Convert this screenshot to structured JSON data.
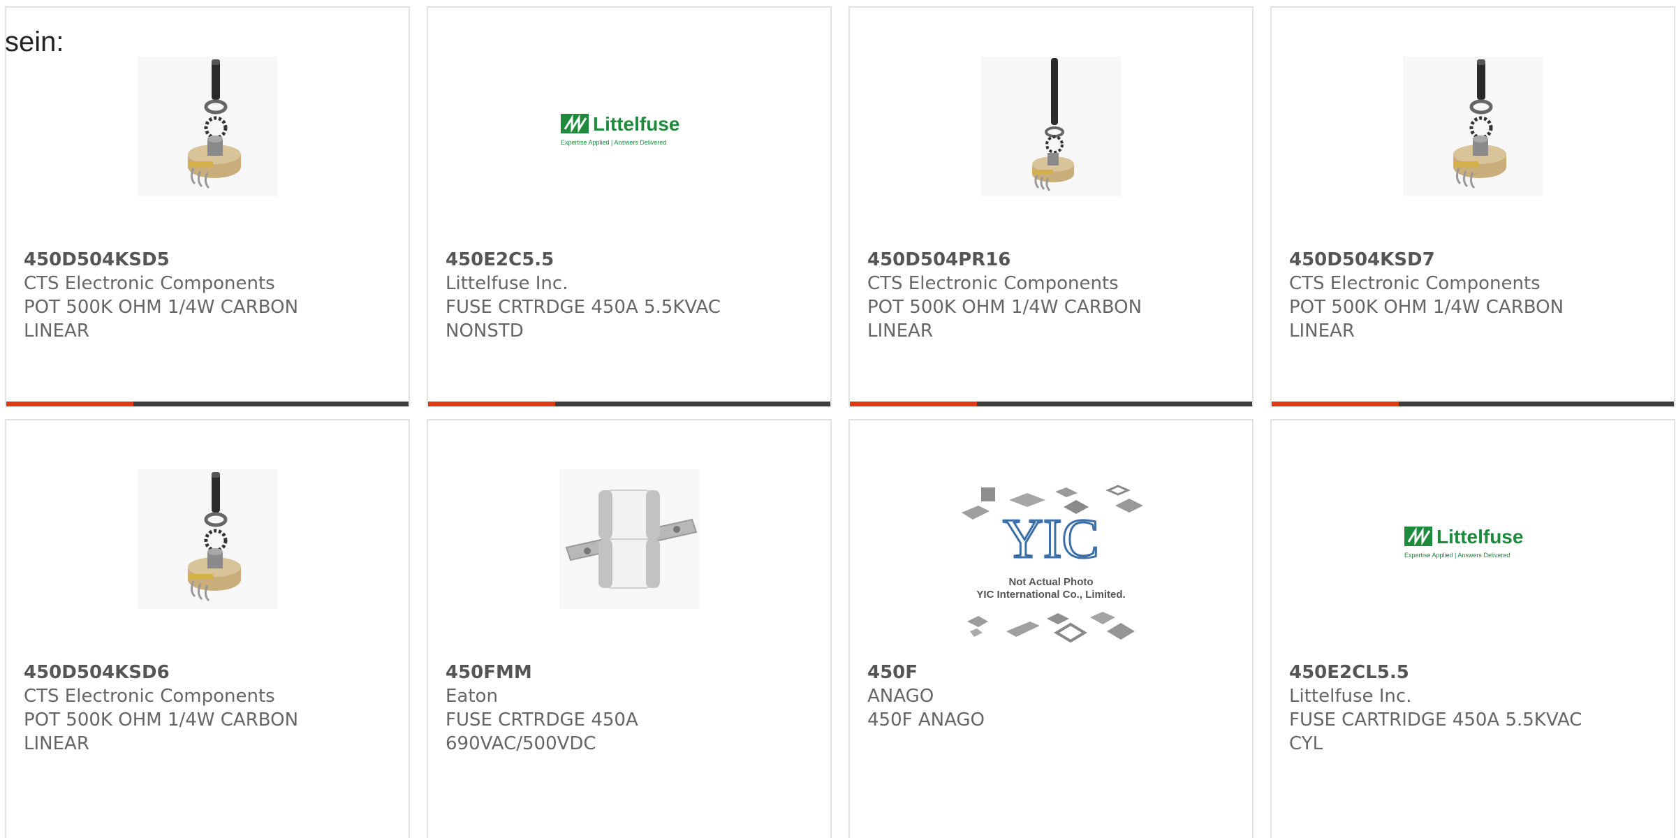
{
  "intro_text": "sein:",
  "colors": {
    "accent_red": "#e03a12",
    "accent_dark": "#3d3d3d",
    "littelfuse_green": "#1e8a3c"
  },
  "products": [
    {
      "part_number": "450D504KSD5",
      "manufacturer": "CTS Electronic Components",
      "description_line1": "POT 500K OHM 1/4W CARBON",
      "description_line2": "LINEAR",
      "image": "potentiometer-image"
    },
    {
      "part_number": "450E2C5.5",
      "manufacturer": "Littelfuse Inc.",
      "description_line1": "FUSE CRTRDGE 450A 5.5KVAC",
      "description_line2": "NONSTD",
      "image": "littelfuse-logo",
      "logo_text": "Littelfuse",
      "logo_tagline": "Expertise Applied | Answers Delivered"
    },
    {
      "part_number": "450D504PR16",
      "manufacturer": "CTS Electronic Components",
      "description_line1": "POT 500K OHM 1/4W CARBON",
      "description_line2": "LINEAR",
      "image": "potentiometer-long-shaft-image"
    },
    {
      "part_number": "450D504KSD7",
      "manufacturer": "CTS Electronic Components",
      "description_line1": "POT 500K OHM 1/4W CARBON",
      "description_line2": "LINEAR",
      "image": "potentiometer-image"
    },
    {
      "part_number": "450D504KSD6",
      "manufacturer": "CTS Electronic Components",
      "description_line1": "POT 500K OHM 1/4W CARBON",
      "description_line2": "LINEAR",
      "image": "potentiometer-image"
    },
    {
      "part_number": "450FMM",
      "manufacturer": "Eaton",
      "description_line1": "FUSE CRTRDGE 450A",
      "description_line2": "690VAC/500VDC",
      "image": "cartridge-fuse-image"
    },
    {
      "part_number": "450F",
      "manufacturer": "ANAGO",
      "description_line1": "450F ANAGO",
      "description_line2": "",
      "image": "yic-placeholder-image",
      "placeholder_line1": "Not Actual Photo",
      "placeholder_line2": "YIC International Co., Limited."
    },
    {
      "part_number": "450E2CL5.5",
      "manufacturer": "Littelfuse Inc.",
      "description_line1": "FUSE CARTRIDGE 450A 5.5KVAC",
      "description_line2": "CYL",
      "image": "littelfuse-logo",
      "logo_text": "Littelfuse",
      "logo_tagline": "Expertise Applied | Answers Delivered"
    }
  ]
}
